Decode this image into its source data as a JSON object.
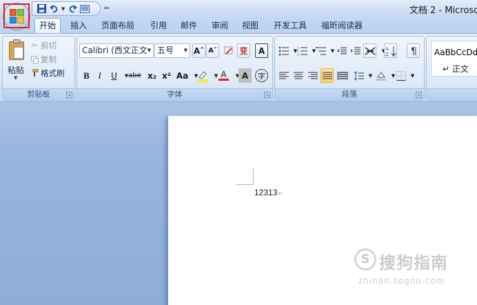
{
  "window": {
    "title": "文档 2 - Microsof"
  },
  "quick_access": {
    "save_icon": "save-icon",
    "undo_icon": "undo-icon",
    "redo_icon": "redo-icon",
    "print_preview_icon": "print-preview-icon",
    "customize_glyph": "="
  },
  "tabs": [
    {
      "label": "开始",
      "active": true
    },
    {
      "label": "插入"
    },
    {
      "label": "页面布局"
    },
    {
      "label": "引用"
    },
    {
      "label": "邮件"
    },
    {
      "label": "审阅"
    },
    {
      "label": "视图"
    },
    {
      "label": "开发工具"
    },
    {
      "label": "福昕阅读器"
    }
  ],
  "clipboard": {
    "paste_label": "粘贴",
    "cut_label": "剪切",
    "copy_label": "复制",
    "format_painter_label": "格式刷",
    "group_label": "剪贴板"
  },
  "font": {
    "font_name": "Calibri (西文正文",
    "font_size": "五号",
    "group_label": "字体",
    "grow_label": "Aˆ",
    "shrink_label": "Aˇ",
    "bold_label": "B",
    "italic_label": "I",
    "underline_label": "U",
    "strike_label": "abe",
    "subscript_label": "x₂",
    "superscript_label": "x²",
    "case_label": "Aa",
    "font_color_label": "A",
    "char_shading_label": "A",
    "enclose_label": "字",
    "phonetic_label": "变",
    "char_border_label": "A",
    "highlight_color": "#f6e93a",
    "font_color": "#e51b1b"
  },
  "paragraph": {
    "group_label": "段落"
  },
  "styles": {
    "sample_text": "AaBbCcDdI",
    "style_name": "↵ 正文"
  },
  "document": {
    "text": "12313",
    "para_mark": "↵"
  },
  "watermark": {
    "logo_glyph": "S",
    "text": "搜狗指南",
    "url": "zhinan.sogou.com"
  }
}
